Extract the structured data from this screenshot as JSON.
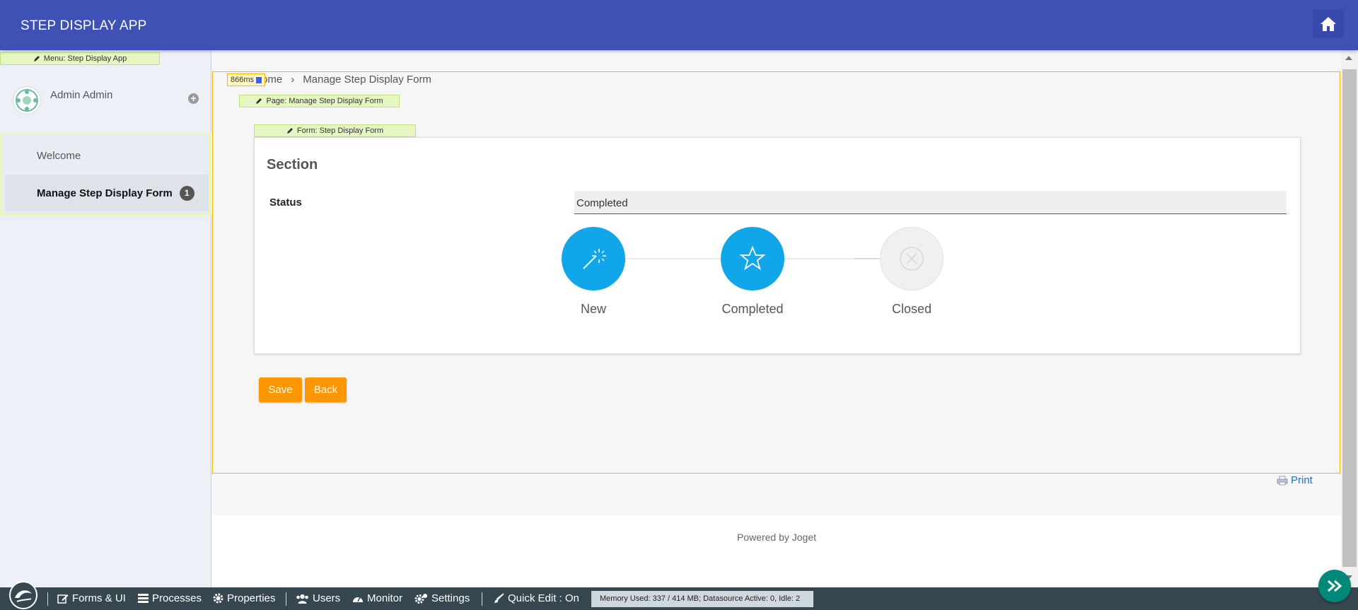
{
  "header": {
    "app_title": "STEP DISPLAY APP",
    "home_icon": "home-icon"
  },
  "sidebar": {
    "menu_tag": "Menu: Step Display App",
    "user_name": "Admin Admin",
    "menu": [
      {
        "label": "Welcome"
      },
      {
        "label": "Manage Step Display Form",
        "badge": "1"
      }
    ]
  },
  "main": {
    "timing": "866ms",
    "breadcrumb": {
      "home": "ome",
      "current": "Manage Step Display Form"
    },
    "page_tag": "Page: Manage Step Display Form",
    "form_tag": "Form: Step Display Form",
    "form": {
      "section_title": "Section",
      "status_label": "Status",
      "status_value": "Completed",
      "steps": [
        {
          "label": "New",
          "icon": "magic-wand-icon",
          "state": "active"
        },
        {
          "label": "Completed",
          "icon": "star-icon",
          "state": "active"
        },
        {
          "label": "Closed",
          "icon": "close-circle-icon",
          "state": "inactive"
        }
      ]
    },
    "buttons": {
      "save": "Save",
      "back": "Back"
    },
    "print": "Print",
    "powered_by": "Powered by Joget"
  },
  "admin_bar": {
    "items": [
      {
        "label": "Forms & UI",
        "icon": "edit-icon"
      },
      {
        "label": "Processes",
        "icon": "list-icon"
      },
      {
        "label": "Properties",
        "icon": "gear-icon"
      },
      {
        "label": "Users",
        "icon": "users-icon"
      },
      {
        "label": "Monitor",
        "icon": "dashboard-icon"
      },
      {
        "label": "Settings",
        "icon": "gears-icon"
      },
      {
        "label": "Quick Edit : On",
        "icon": "brush-icon"
      }
    ],
    "memory": "Memory Used: 337 / 414 MB; Datasource Active: 0, Idle: 2"
  },
  "colors": {
    "header": "#3f51b5",
    "step_active": "#11a5e9",
    "button": "#ff9800",
    "admin_bar": "#37474f",
    "quick_edit_tag": "#e6f6c3",
    "outline": "#f4b400"
  }
}
